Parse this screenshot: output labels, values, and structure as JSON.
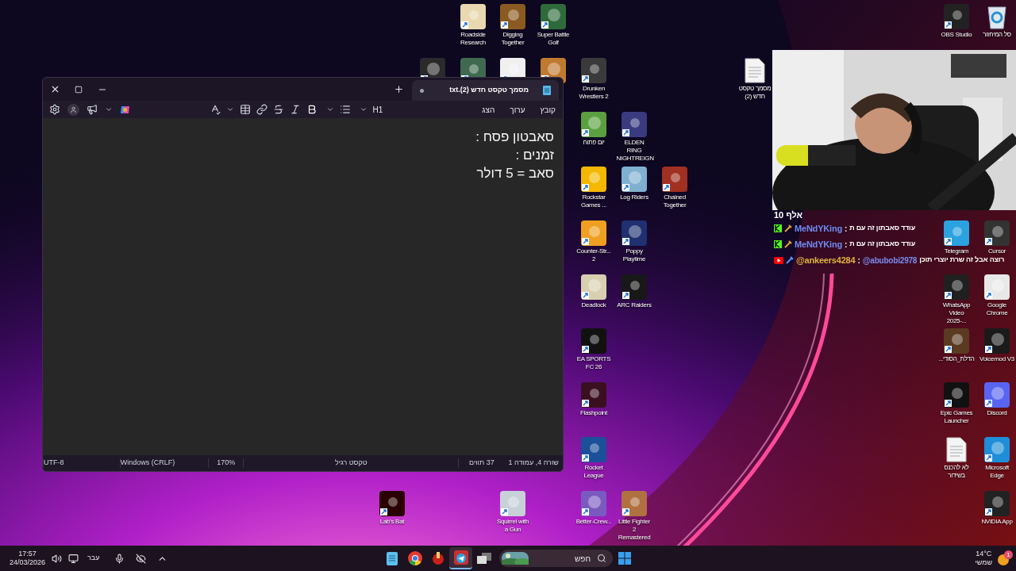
{
  "desktop_icons": [
    {
      "kind": "app",
      "label": "Roadside Research"
    },
    {
      "kind": "app",
      "label": "Digging Together"
    },
    {
      "kind": "app",
      "label": "Super Battle Golf"
    },
    {
      "kind": "app",
      "label": "OBS Studio"
    },
    {
      "kind": "recycle",
      "label": "סל המיחזור"
    },
    {
      "kind": "app"
    },
    {
      "kind": "app"
    },
    {
      "kind": "app"
    },
    {
      "kind": "app"
    },
    {
      "kind": "app",
      "label": "Drunken Wrestlers 2"
    },
    {
      "kind": "file",
      "label": "מסמך טקסט חדש (2)"
    },
    {
      "kind": "app",
      "label": "יום פתוח"
    },
    {
      "kind": "app",
      "label": "ELDEN RING NIGHTREIGN"
    },
    {
      "kind": "app",
      "label": "Rockstar Games ..."
    },
    {
      "kind": "app",
      "label": "Log Riders"
    },
    {
      "kind": "app",
      "label": "Chained Together"
    },
    {
      "kind": "app",
      "label": "Counter-Str... 2"
    },
    {
      "kind": "app",
      "label": "Poppy Playtime"
    },
    {
      "kind": "app",
      "label": "Telegram"
    },
    {
      "kind": "app",
      "label": "Cursor"
    },
    {
      "kind": "app",
      "label": "Deadlock"
    },
    {
      "kind": "app",
      "label": "ARC Raiders"
    },
    {
      "kind": "app",
      "label": "WhatsApp Video 2025-..."
    },
    {
      "kind": "app",
      "label": "Google Chrome"
    },
    {
      "kind": "app",
      "label": "EA SPORTS FC 26"
    },
    {
      "kind": "app",
      "label": "הדלת_הסודי..."
    },
    {
      "kind": "app",
      "label": "Voicemod V3"
    },
    {
      "kind": "app",
      "label": "Flashpoint"
    },
    {
      "kind": "app",
      "label": "Epic Games Launcher"
    },
    {
      "kind": "app",
      "label": "Discord"
    },
    {
      "kind": "app",
      "label": "Rocket League"
    },
    {
      "kind": "file",
      "label": "לא להכנס בשידור"
    },
    {
      "kind": "app",
      "label": "Microsoft Edge"
    },
    {
      "kind": "app",
      "label": "Lab's Bat"
    },
    {
      "kind": "app",
      "label": "Squirrel with a Gun"
    },
    {
      "kind": "app",
      "label": "Better-Crew..."
    },
    {
      "kind": "app",
      "label": "Little Fighter 2 Remastered"
    },
    {
      "kind": "app",
      "label": "NVIDIA App"
    }
  ],
  "notepad": {
    "tab": {
      "title": "מסמך טקסט חדש (2).txt",
      "unsaved": true,
      "selected": true
    },
    "menu": [
      "קובץ",
      "ערוך",
      "הצג"
    ],
    "heading_button": "H1",
    "lines": [
      "סאבטון פסח :",
      "זמנים :",
      "סאב = 5 דולר"
    ],
    "status_bar": [
      "UTF-8",
      "Windows (CRLF)",
      "170%",
      "טקסט רגיל",
      "37 תווים",
      "שורה 4, עמודה 1"
    ]
  },
  "chat": {
    "viewer_count": "10 אלף",
    "messages": [
      {
        "kind": "kick",
        "user": "MeNdYKing",
        "color": "#6f8cf0",
        "separator": ":",
        "text": "עודד סאבתון זה עם ת"
      },
      {
        "kind": "kick",
        "user": "MeNdYKing",
        "color": "#6f8cf0",
        "separator": ":",
        "text": "עודד סאבתון זה עם ת"
      },
      {
        "kind": "youtube",
        "user": "@ankeers4284",
        "color": "#e0b43c",
        "separator": ":",
        "mention": "@abubobi2978",
        "text": "רוצה אבל זה שרת יוצרי תוכן"
      }
    ]
  },
  "taskbar": {
    "time": "17:57",
    "date": "24/03/2026",
    "language": "עבר",
    "apps": [
      {
        "kind": "notepad",
        "selected": false
      },
      {
        "kind": "chrome",
        "selected": false
      },
      {
        "kind": "game",
        "selected": false
      },
      {
        "kind": "telegram",
        "selected": true
      },
      {
        "kind": "task_view",
        "selected": false
      }
    ],
    "search_placeholder": "חפש",
    "weather": {
      "temperature": "14°C",
      "condition": "שמשי",
      "badge": "1"
    }
  }
}
